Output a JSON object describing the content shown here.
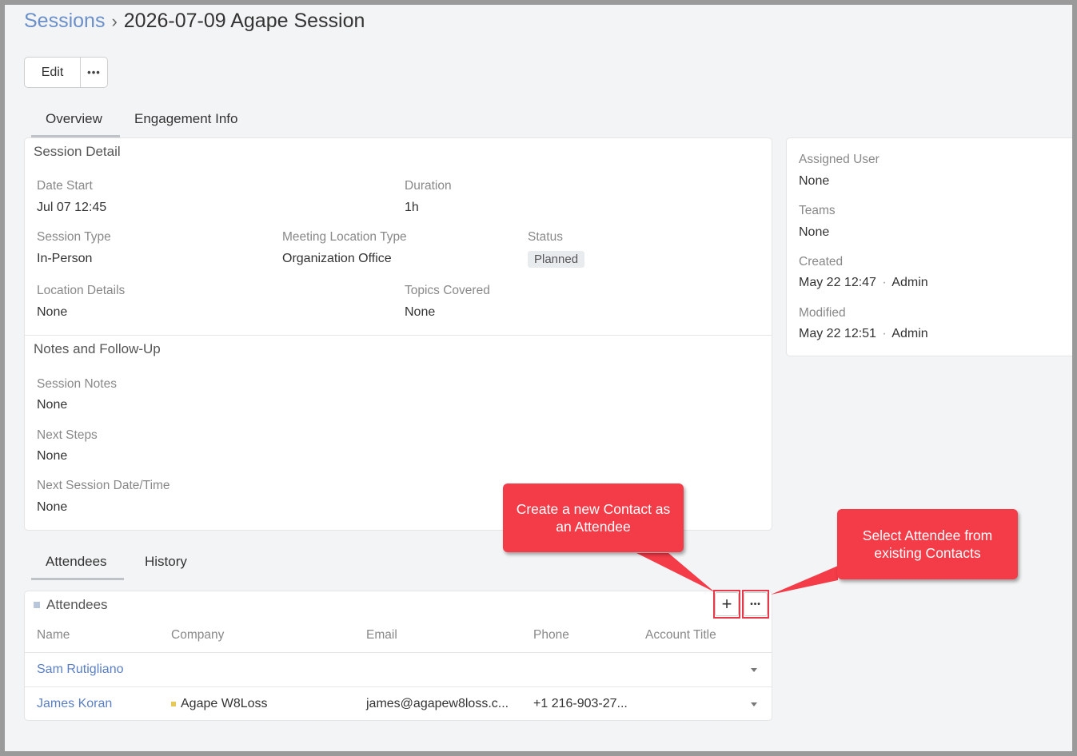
{
  "breadcrumb": {
    "parent": "Sessions",
    "separator": "›",
    "current": "2026-07-09 Agape Session"
  },
  "toolbar": {
    "edit_label": "Edit",
    "more_label": "•••"
  },
  "tabs": [
    {
      "label": "Overview",
      "active": true
    },
    {
      "label": "Engagement Info",
      "active": false
    }
  ],
  "session_detail": {
    "title": "Session Detail",
    "date_start_label": "Date Start",
    "date_start": "Jul 07 12:45",
    "duration_label": "Duration",
    "duration": "1h",
    "session_type_label": "Session Type",
    "session_type": "In-Person",
    "meeting_location_type_label": "Meeting Location Type",
    "meeting_location_type": "Organization Office",
    "status_label": "Status",
    "status": "Planned",
    "location_details_label": "Location Details",
    "location_details": "None",
    "topics_covered_label": "Topics Covered",
    "topics_covered": "None"
  },
  "notes": {
    "title": "Notes and Follow-Up",
    "session_notes_label": "Session Notes",
    "session_notes": "None",
    "next_steps_label": "Next Steps",
    "next_steps": "None",
    "next_session_label": "Next Session Date/Time",
    "next_session": "None"
  },
  "side_panel": {
    "assigned_user_label": "Assigned User",
    "assigned_user": "None",
    "teams_label": "Teams",
    "teams": "None",
    "created_label": "Created",
    "created_date": "May 22 12:47",
    "created_by": "Admin",
    "modified_label": "Modified",
    "modified_date": "May 22 12:51",
    "modified_by": "Admin",
    "dot": "·"
  },
  "bottom_tabs": [
    {
      "label": "Attendees",
      "active": true
    },
    {
      "label": "History",
      "active": false
    }
  ],
  "attendees": {
    "title": "Attendees",
    "add_label": "+",
    "more_label": "•••",
    "columns": [
      "Name",
      "Company",
      "Email",
      "Phone",
      "Account Title"
    ],
    "rows": [
      {
        "name": "Sam Rutigliano",
        "company": "",
        "email": "",
        "phone": "",
        "account_title": ""
      },
      {
        "name": "James Koran",
        "company": "Agape W8Loss",
        "email": "james@agapew8loss.c...",
        "phone": "+1 216-903-27...",
        "account_title": ""
      }
    ]
  },
  "callouts": {
    "create": "Create a new Contact as an Attendee",
    "select": "Select Attendee from existing Contacts"
  },
  "colors": {
    "link": "#5a7fc4",
    "callout": "#f43b48",
    "attendees_icon": "#b8c6dc",
    "company_icon": "#e8c75a"
  }
}
